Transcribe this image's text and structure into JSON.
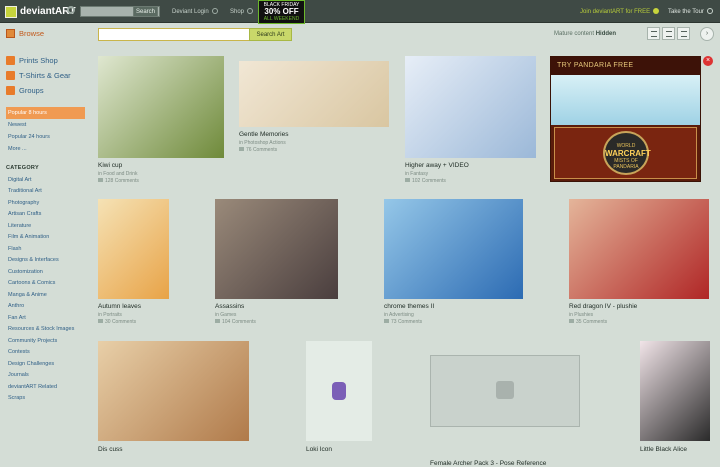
{
  "topbar": {
    "logo": "deviantART",
    "search_button": "Search",
    "deviant_login": "Deviant Login",
    "shop": "Shop",
    "black_friday": {
      "line1": "BLACK FRIDAY",
      "line2": "30% OFF",
      "line3": "ALL WEEKEND"
    },
    "join": "Join deviantART for FREE",
    "tour": "Take the Tour"
  },
  "subbar": {
    "browse": "Browse",
    "search_button": "Search Art",
    "search_value": "",
    "mature_label": "Mature content",
    "mature_value": "Hidden"
  },
  "sidebar": {
    "links": [
      {
        "label": "Prints Shop",
        "color": "#e87b2a"
      },
      {
        "label": "T-Shirts & Gear",
        "color": "#e87b2a"
      },
      {
        "label": "Groups",
        "color": "#e87b2a"
      }
    ],
    "sort": [
      {
        "label": "Popular 8 hours",
        "active": true
      },
      {
        "label": "Newest",
        "active": false
      },
      {
        "label": "Popular 24 hours",
        "active": false
      },
      {
        "label": "More ...",
        "active": false
      }
    ],
    "category_heading": "CATEGORY",
    "categories": [
      "Digital Art",
      "Traditional Art",
      "Photography",
      "Artisan Crafts",
      "Literature",
      "Film & Animation",
      "Flash",
      "Designs & Interfaces",
      "Customization",
      "Cartoons & Comics",
      "Manga & Anime",
      "Anthro",
      "Fan Art",
      "Resources & Stock Images",
      "Community Projects",
      "Contests",
      "Design Challenges",
      "Journals",
      "deviantART Related",
      "Scraps"
    ]
  },
  "art": [
    {
      "title": "Kiwi cup",
      "category": "in Food and Drink",
      "comments": "128 Comments",
      "colors": [
        "#6f8a3a",
        "#dfe7d0"
      ]
    },
    {
      "title": "Gentle Memories",
      "category": "in Photoshop Actions",
      "comments": "76 Comments",
      "colors": [
        "#d9c6a1",
        "#f1e7d5"
      ]
    },
    {
      "title": "Higher away + VIDEO",
      "category": "in Fantasy",
      "comments": "102 Comments",
      "colors": [
        "#9bb8d8",
        "#e7eef7"
      ]
    },
    {
      "title": "Autumn leaves",
      "category": "in Portraits",
      "comments": "30 Comments",
      "colors": [
        "#e8a347",
        "#f5e2b5"
      ]
    },
    {
      "title": "Assassins",
      "category": "in Games",
      "comments": "104 Comments",
      "colors": [
        "#4a3e3e",
        "#9a8a7a"
      ]
    },
    {
      "title": "chrome themes II",
      "category": "in Advertising",
      "comments": "73 Comments",
      "colors": [
        "#2c6bb3",
        "#95c7e8"
      ]
    },
    {
      "title": "Red dragon IV - plushie",
      "category": "in Plushies",
      "comments": "35 Comments",
      "colors": [
        "#b02626",
        "#e4b59a"
      ]
    },
    {
      "title": "Dis cuss",
      "category": "",
      "comments": "",
      "colors": [
        "#b07a4a",
        "#e8cfa8"
      ]
    },
    {
      "title": "Loki Icon",
      "category": "",
      "comments": "",
      "colors": [
        "#e4ece6",
        "#e4ece6"
      ]
    },
    {
      "title": "Female Archer Pack 3 - Pose Reference",
      "category": "",
      "comments": "",
      "colors": [
        "#c9d2cc",
        "#c9d2cc"
      ]
    },
    {
      "title": "Little Black Alice",
      "category": "",
      "comments": "",
      "colors": [
        "#2a2a2a",
        "#f1e4e8"
      ]
    }
  ],
  "ad": {
    "headline": "TRY PANDARIA FREE",
    "logo_line1": "WORLD",
    "logo_line2": "WARCRAFT",
    "logo_line3": "MISTS OF PANDARIA"
  }
}
